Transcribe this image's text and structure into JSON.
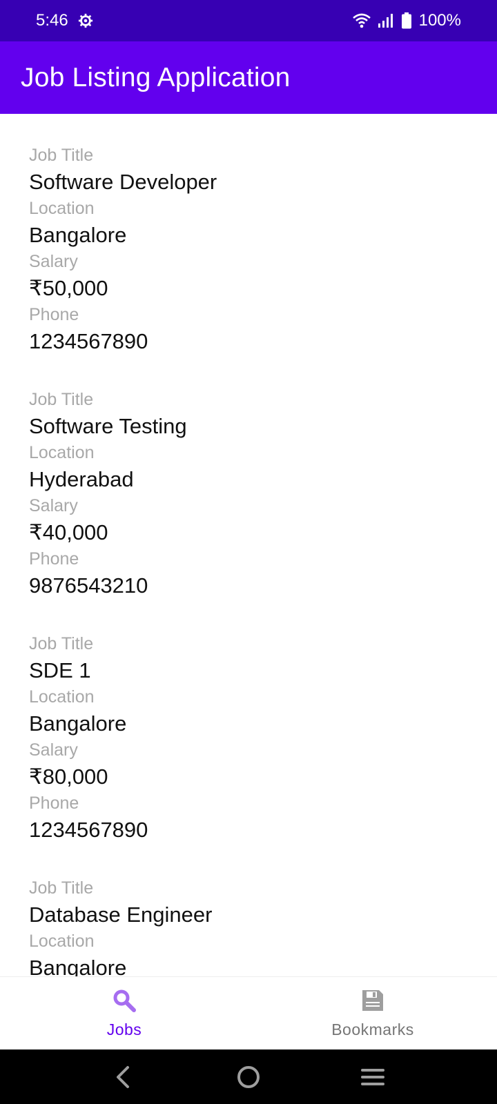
{
  "status_bar": {
    "time": "5:46",
    "battery": "100%",
    "icons": [
      "gear-icon",
      "wifi-icon",
      "signal-icon",
      "battery-icon"
    ]
  },
  "app_bar": {
    "title": "Job Listing Application"
  },
  "labels": {
    "job_title": "Job Title",
    "location": "Location",
    "salary": "Salary",
    "phone": "Phone"
  },
  "jobs": [
    {
      "title": "Software Developer",
      "location": "Bangalore",
      "salary": "₹50,000",
      "phone": "1234567890"
    },
    {
      "title": "Software Testing",
      "location": "Hyderabad",
      "salary": "₹40,000",
      "phone": "9876543210"
    },
    {
      "title": "SDE 1",
      "location": "Bangalore",
      "salary": "₹80,000",
      "phone": "1234567890"
    },
    {
      "title": "Database Engineer",
      "location": "Bangalore"
    }
  ],
  "bottom_nav": {
    "items": [
      {
        "label": "Jobs",
        "icon": "search-icon",
        "active": true
      },
      {
        "label": "Bookmarks",
        "icon": "save-icon",
        "active": false
      }
    ]
  },
  "colors": {
    "status_bar": "#3700b3",
    "app_bar": "#6200ee",
    "active_nav": "#6200ee",
    "active_icon": "#a66df0",
    "inactive_nav": "#757575"
  }
}
